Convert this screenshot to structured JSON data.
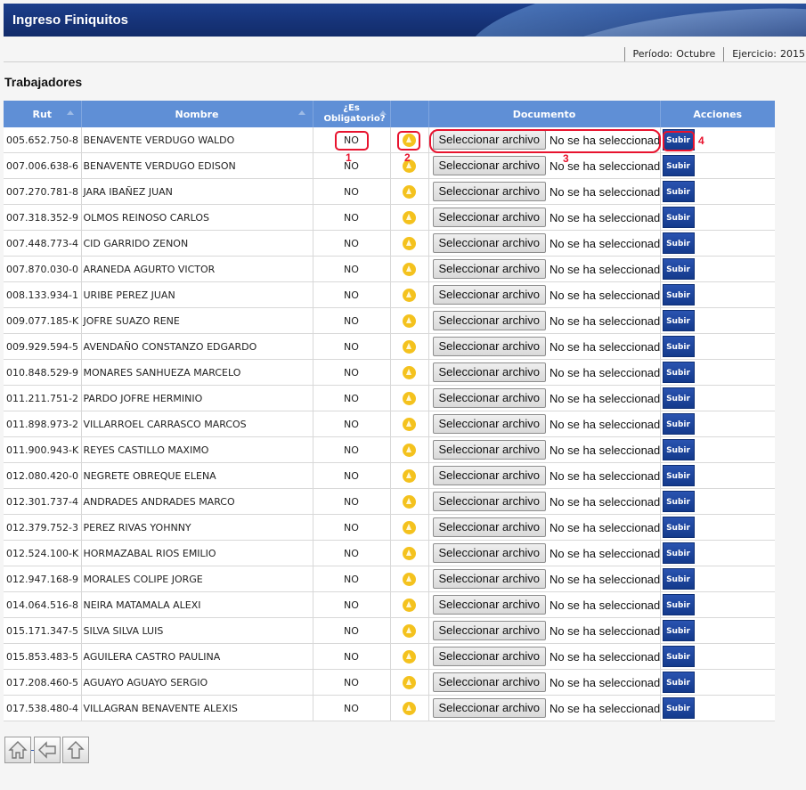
{
  "header": {
    "title": "Ingreso Finiquitos"
  },
  "period": {
    "periodo_label": "Período:",
    "periodo_value": "Octubre",
    "ejercicio_label": "Ejercicio:",
    "ejercicio_value": "2015"
  },
  "section": {
    "title": "Trabajadores"
  },
  "columns": {
    "rut": "Rut",
    "nombre": "Nombre",
    "obligatorio": "¿Es Obligatorio?",
    "documento": "Documento",
    "acciones": "Acciones"
  },
  "labels": {
    "select_file": "Seleccionar archivo",
    "no_file": "No se ha seleccionado ningún archivo",
    "upload": "Subir"
  },
  "annotations": [
    "1",
    "2",
    "3",
    "4"
  ],
  "colors": {
    "header_blue": "#5f8fd6",
    "title_bar": "#163378",
    "annotation_red": "#e8132e",
    "warning_yellow": "#f4c21e"
  },
  "rows": [
    {
      "rut": "005.652.750-8",
      "nombre": "BENAVENTE VERDUGO WALDO",
      "obligatorio": "NO"
    },
    {
      "rut": "007.006.638-6",
      "nombre": "BENAVENTE VERDUGO EDISON",
      "obligatorio": "NO"
    },
    {
      "rut": "007.270.781-8",
      "nombre": "JARA IBAÑEZ JUAN",
      "obligatorio": "NO"
    },
    {
      "rut": "007.318.352-9",
      "nombre": "OLMOS REINOSO CARLOS",
      "obligatorio": "NO"
    },
    {
      "rut": "007.448.773-4",
      "nombre": "CID GARRIDO ZENON",
      "obligatorio": "NO"
    },
    {
      "rut": "007.870.030-0",
      "nombre": "ARANEDA AGURTO VICTOR",
      "obligatorio": "NO"
    },
    {
      "rut": "008.133.934-1",
      "nombre": "URIBE PEREZ JUAN",
      "obligatorio": "NO"
    },
    {
      "rut": "009.077.185-K",
      "nombre": "JOFRE SUAZO RENE",
      "obligatorio": "NO"
    },
    {
      "rut": "009.929.594-5",
      "nombre": "AVENDAÑO CONSTANZO EDGARDO",
      "obligatorio": "NO"
    },
    {
      "rut": "010.848.529-9",
      "nombre": "MONARES SANHUEZA MARCELO",
      "obligatorio": "NO"
    },
    {
      "rut": "011.211.751-2",
      "nombre": "PARDO JOFRE HERMINIO",
      "obligatorio": "NO"
    },
    {
      "rut": "011.898.973-2",
      "nombre": "VILLARROEL CARRASCO MARCOS",
      "obligatorio": "NO"
    },
    {
      "rut": "011.900.943-K",
      "nombre": "REYES CASTILLO MAXIMO",
      "obligatorio": "NO"
    },
    {
      "rut": "012.080.420-0",
      "nombre": "NEGRETE OBREQUE ELENA",
      "obligatorio": "NO"
    },
    {
      "rut": "012.301.737-4",
      "nombre": "ANDRADES ANDRADES MARCO",
      "obligatorio": "NO"
    },
    {
      "rut": "012.379.752-3",
      "nombre": "PEREZ RIVAS YOHNNY",
      "obligatorio": "NO"
    },
    {
      "rut": "012.524.100-K",
      "nombre": "HORMAZABAL RIOS EMILIO",
      "obligatorio": "NO"
    },
    {
      "rut": "012.947.168-9",
      "nombre": "MORALES COLIPE JORGE",
      "obligatorio": "NO"
    },
    {
      "rut": "014.064.516-8",
      "nombre": "NEIRA MATAMALA ALEXI",
      "obligatorio": "NO"
    },
    {
      "rut": "015.171.347-5",
      "nombre": "SILVA SILVA LUIS",
      "obligatorio": "NO"
    },
    {
      "rut": "015.853.483-5",
      "nombre": "AGUILERA CASTRO PAULINA",
      "obligatorio": "NO"
    },
    {
      "rut": "017.208.460-5",
      "nombre": "AGUAYO AGUAYO SERGIO",
      "obligatorio": "NO"
    },
    {
      "rut": "017.538.480-4",
      "nombre": "VILLAGRAN BENAVENTE ALEXIS",
      "obligatorio": "NO"
    }
  ],
  "footer_nav": [
    "home-icon",
    "arrow-left-icon",
    "arrow-up-icon"
  ]
}
